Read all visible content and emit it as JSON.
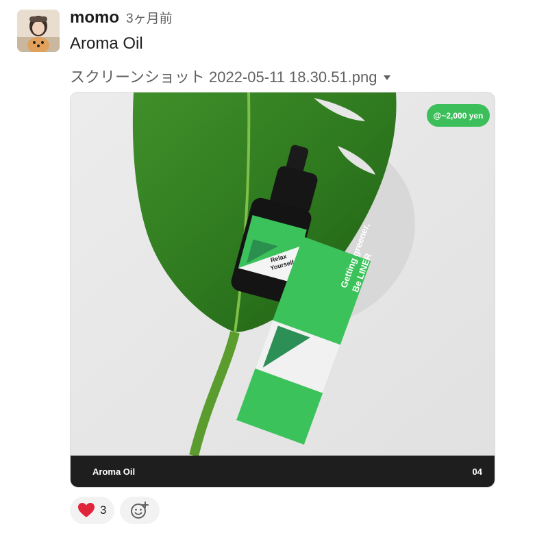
{
  "message": {
    "author": "momo",
    "timestamp": "3ヶ月前",
    "text": "Aroma Oil"
  },
  "file": {
    "name": "スクリーンショット 2022-05-11 18.30.51.png",
    "image": {
      "price_badge": "@~2,000 yen",
      "bottle_label": "Relax\nYourself",
      "box_text": "Getting greener,\nBe LINER",
      "caption_title": "Aroma Oil",
      "caption_page": "04"
    }
  },
  "reactions": [
    {
      "emoji": "❤️",
      "count": "3"
    }
  ],
  "colors": {
    "accent_green": "#3cbf5b",
    "caption_bg": "#1e1e1e",
    "text_muted": "#616061"
  },
  "icons": {
    "caret": "chevron-down-icon",
    "add_reaction": "add-reaction-icon"
  }
}
